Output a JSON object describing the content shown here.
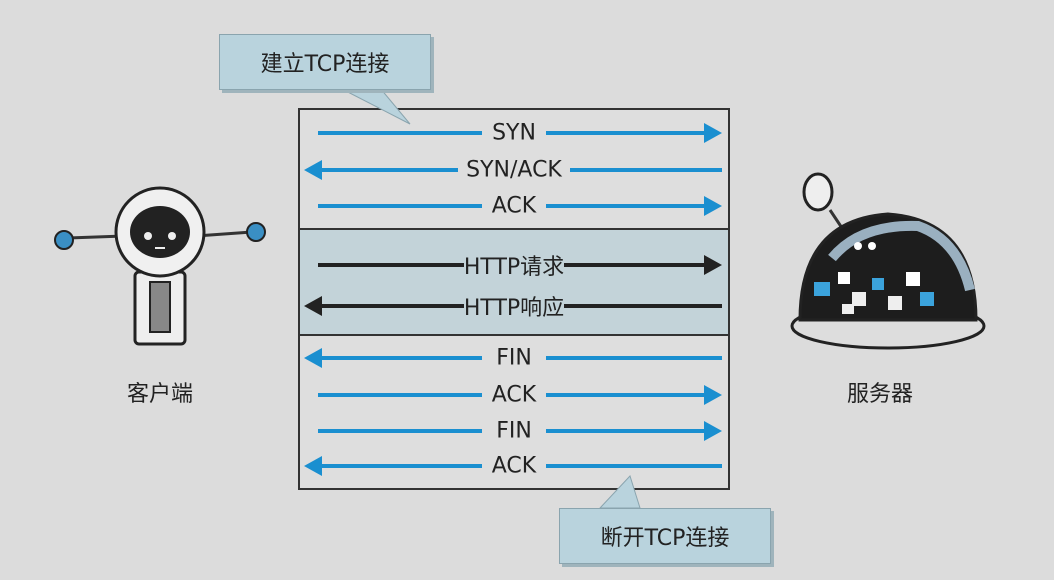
{
  "callouts": {
    "establish": "建立TCP连接",
    "terminate": "断开TCP连接"
  },
  "labels": {
    "client": "客户端",
    "server": "服务器"
  },
  "messages": [
    {
      "text": "SYN",
      "dir": "right",
      "color": "#1a8fd0"
    },
    {
      "text": "SYN/ACK",
      "dir": "left",
      "color": "#1a8fd0"
    },
    {
      "text": "ACK",
      "dir": "right",
      "color": "#1a8fd0"
    },
    {
      "text": "HTTP请求",
      "dir": "right",
      "color": "#222222"
    },
    {
      "text": "HTTP响应",
      "dir": "left",
      "color": "#222222"
    },
    {
      "text": "FIN",
      "dir": "left",
      "color": "#1a8fd0"
    },
    {
      "text": "ACK",
      "dir": "right",
      "color": "#1a8fd0"
    },
    {
      "text": "FIN",
      "dir": "right",
      "color": "#1a8fd0"
    },
    {
      "text": "ACK",
      "dir": "left",
      "color": "#1a8fd0"
    }
  ],
  "colors": {
    "tcp_arrow": "#1a8fd0",
    "http_arrow": "#222222",
    "http_band": "#c3d3d9",
    "callout": "#b9d3dd"
  }
}
